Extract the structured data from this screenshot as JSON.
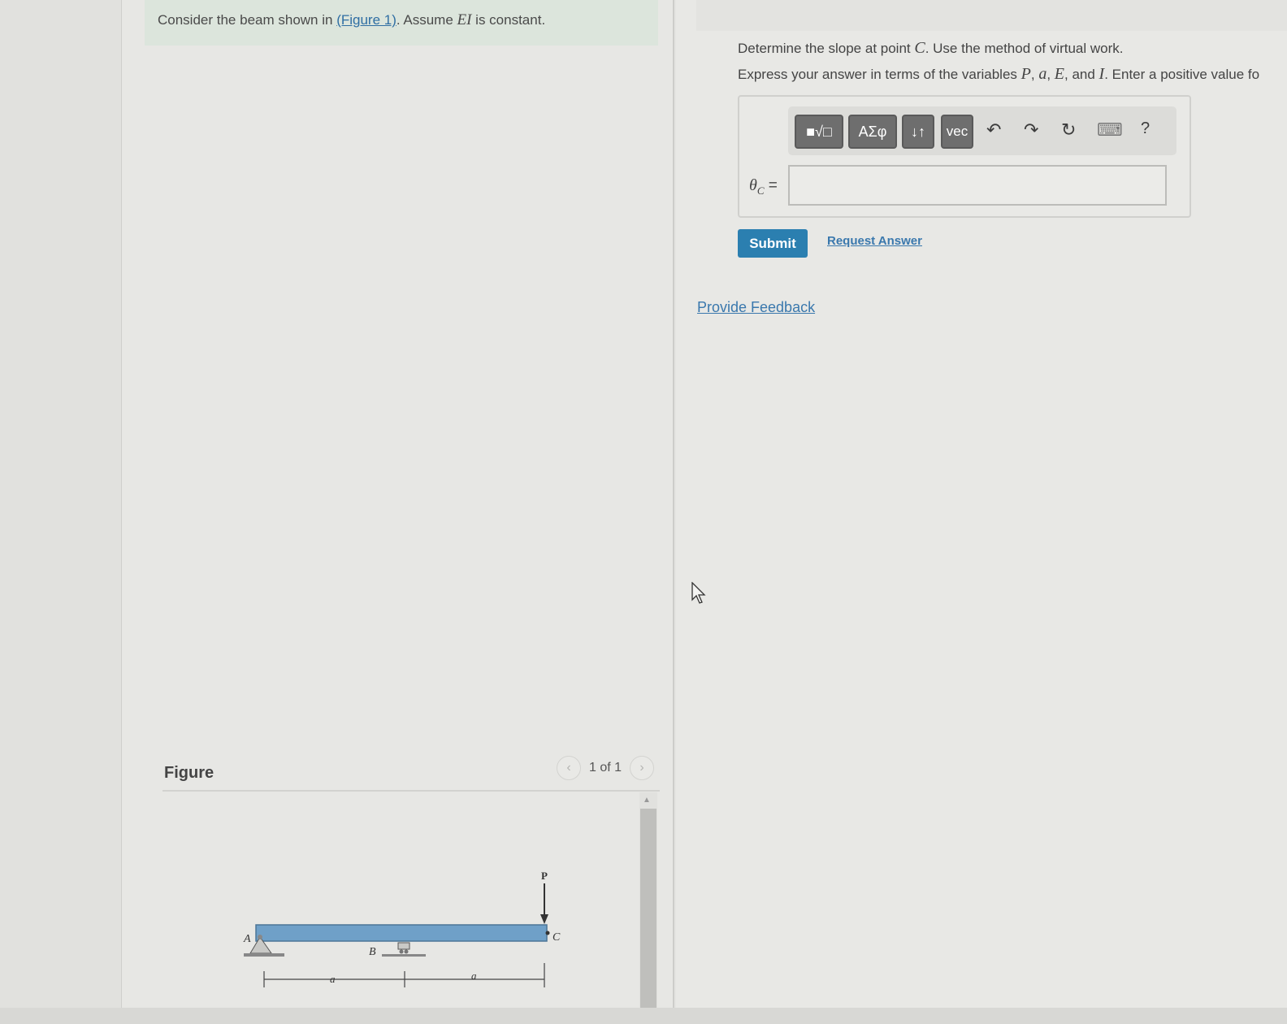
{
  "problem": {
    "text_before": "Consider the beam shown in ",
    "figure_link": "(Figure 1)",
    "text_mid": ". Assume ",
    "ei": "EI",
    "text_after": " is constant."
  },
  "figure": {
    "label": "Figure",
    "counter": "1 of 1",
    "prev_glyph": "‹",
    "next_glyph": "›",
    "labels": {
      "A": "A",
      "B": "B",
      "C": "C",
      "P": "P",
      "a1": "a",
      "a2": "a"
    }
  },
  "question": {
    "line1_before": "Determine the slope at point ",
    "line1_var": "C",
    "line1_after": ". Use the method of virtual work.",
    "line2_before": "Express your answer in terms of the variables ",
    "v1": "P",
    "v2": "a",
    "v3": "E",
    "and": " and ",
    "v4": "I",
    "line2_after": ". Enter a positive value fo"
  },
  "toolbar": {
    "templates": "■√□",
    "greek": "ΑΣφ",
    "arrows": "↓↑",
    "vec": "vec",
    "undo": "↶",
    "redo": "↷",
    "reset": "↻",
    "keyboard": "⌨",
    "help": "?"
  },
  "answer": {
    "variable": "θC",
    "variable_main": "θ",
    "variable_sub": "C",
    "equals": " =",
    "value": ""
  },
  "actions": {
    "submit": "Submit",
    "request": "Request Answer",
    "feedback": "Provide Feedback"
  },
  "colors": {
    "submit_bg": "#2b7fb0",
    "link": "#3a78ad",
    "beam": "#6fa0c8",
    "banner": "#dce5dc"
  }
}
